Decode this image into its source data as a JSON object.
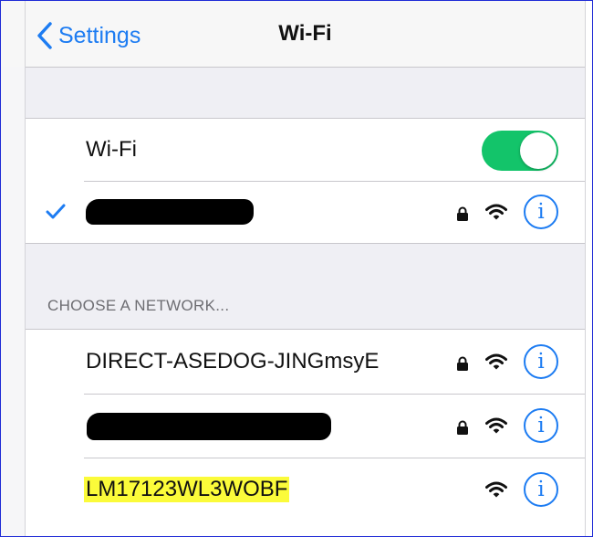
{
  "navbar": {
    "back_label": "Settings",
    "title": "Wi-Fi"
  },
  "wifi_toggle": {
    "label": "Wi-Fi",
    "on": true
  },
  "connected_network": {
    "name_redacted": true,
    "secured": true,
    "icons": [
      "checkmark-icon",
      "lock-icon",
      "wifi-signal-icon",
      "info-icon"
    ]
  },
  "choose_network": {
    "header": "CHOOSE A NETWORK...",
    "networks": [
      {
        "name": "DIRECT-ASEDOG-JINGmsyE",
        "secured": true
      },
      {
        "name": "",
        "redacted": true,
        "secured": true
      },
      {
        "name": "LM17123WL3WOBF",
        "secured": false,
        "highlighted": true
      }
    ]
  },
  "info_glyph": "i",
  "colors": {
    "accent": "#1d7cf2",
    "toggle_on": "#13c46a",
    "highlight": "#fbfb3a",
    "frame_border": "#1f2bd6"
  }
}
